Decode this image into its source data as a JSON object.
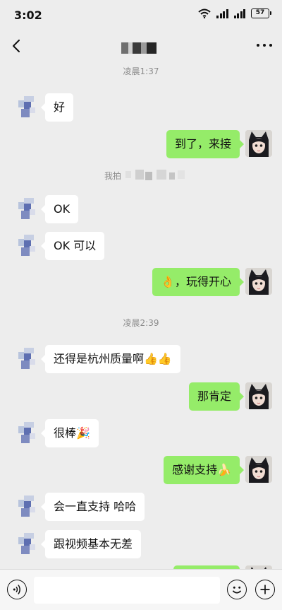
{
  "status_bar": {
    "time": "3:02",
    "battery": "57"
  },
  "nav": {
    "title": ""
  },
  "timestamps": [
    "凌晨1:37",
    "凌晨2:39"
  ],
  "system_message": "我拍",
  "messages": [
    {
      "side": "left",
      "text": "好"
    },
    {
      "side": "right",
      "text": "到了，来接"
    },
    {
      "side": "left",
      "text": "OK"
    },
    {
      "side": "left",
      "text": "OK 可以"
    },
    {
      "side": "right",
      "text": "👌，玩得开心"
    },
    {
      "side": "left",
      "text": "还得是杭州质量啊👍👍"
    },
    {
      "side": "right",
      "text": "那肯定"
    },
    {
      "side": "left",
      "text": "很棒🎉"
    },
    {
      "side": "right",
      "text": "感谢支持🍌"
    },
    {
      "side": "left",
      "text": "会一直支持 哈哈"
    },
    {
      "side": "left",
      "text": "跟视频基本无差"
    },
    {
      "side": "right",
      "text": ""
    }
  ],
  "input": {
    "placeholder": ""
  },
  "colors": {
    "background": "#ededed",
    "my_bubble": "#95ec69",
    "their_bubble": "#ffffff"
  }
}
